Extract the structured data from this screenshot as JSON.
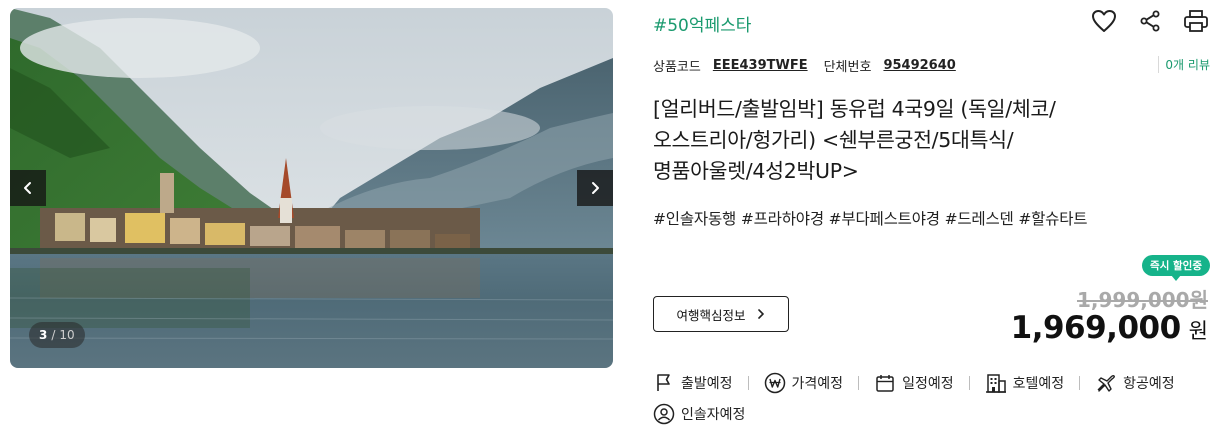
{
  "gallery": {
    "current": "3",
    "separator": "/",
    "total": "10",
    "prev_icon": "chevron-left-icon",
    "next_icon": "chevron-right-icon"
  },
  "product": {
    "festa_tag": "#50억페스타",
    "code_label": "상품코드",
    "code_value": "EEE439TWFE",
    "group_label": "단체번호",
    "group_value": "95492640",
    "reviews": "0개 리뷰",
    "title_lines": [
      "[얼리버드/출발임박] 동유럽 4국9일 (독일/체코/",
      "오스트리아/헝가리) <쉔부른궁전/5대특식/",
      "명품아울렛/4성2박UP>"
    ],
    "hashtags": "#인솔자동행 #프라하야경 #부다페스트야경 #드레스덴 #할슈타트"
  },
  "actions": {
    "icons": [
      "heart-icon",
      "share-icon",
      "print-icon"
    ]
  },
  "price": {
    "badge": "즉시 할인중",
    "original": "1,999,000원",
    "sale_value": "1,969,000",
    "sale_unit": "원",
    "info_button": "여행핵심정보"
  },
  "status": {
    "items": [
      "출발예정",
      "가격예정",
      "일정예정",
      "호텔예정",
      "항공예정",
      "인솔자예정"
    ]
  },
  "colors": {
    "accent": "#1a9a6e",
    "badge": "#16b38a"
  }
}
